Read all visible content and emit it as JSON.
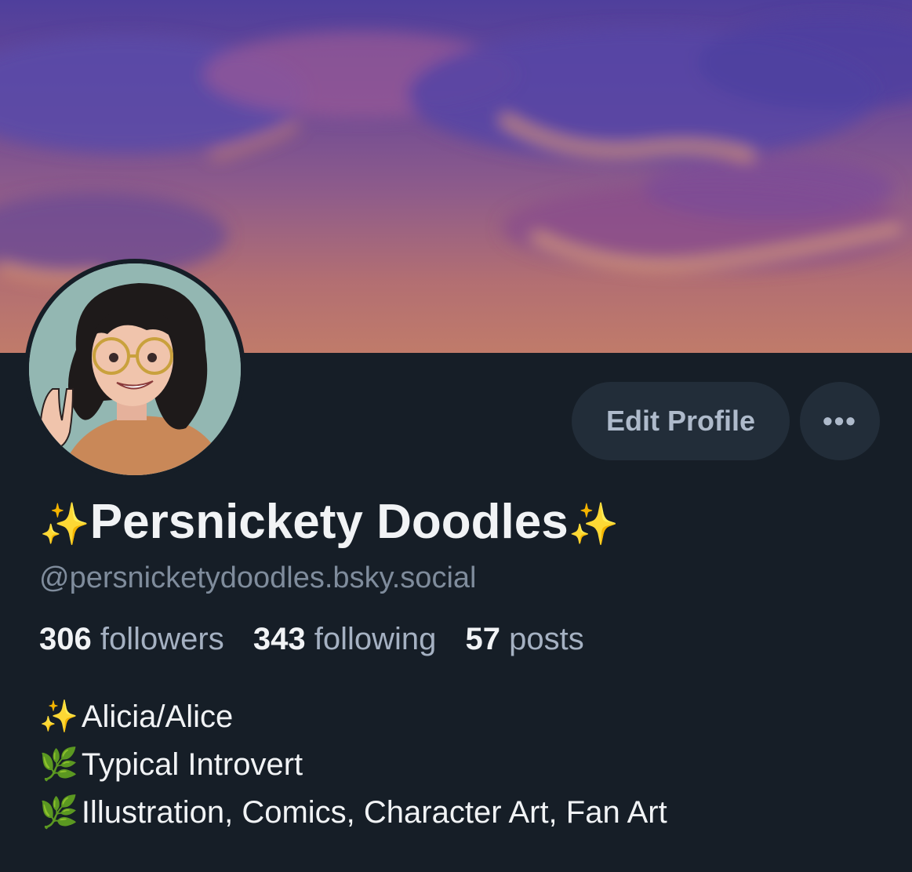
{
  "profile": {
    "display_name": "Persnickety Doodles",
    "name_emoji_left": "✨",
    "name_emoji_right": "✨",
    "handle": "@persnicketydoodles.bsky.social"
  },
  "actions": {
    "edit_label": "Edit Profile",
    "more_label": "•••"
  },
  "stats": {
    "followers_count": "306",
    "followers_label": "followers",
    "following_count": "343",
    "following_label": "following",
    "posts_count": "57",
    "posts_label": "posts"
  },
  "bio": {
    "lines": [
      {
        "emoji": "✨",
        "text": "Alicia/Alice"
      },
      {
        "emoji": "🌿",
        "text": "Typical Introvert"
      },
      {
        "emoji": "🌿",
        "text": "Illustration, Comics, Character Art, Fan Art"
      }
    ]
  },
  "colors": {
    "background": "#161e27",
    "button_bg": "#222d39",
    "muted_text": "#7f8c9c",
    "primary_text": "#f1f3f5"
  }
}
